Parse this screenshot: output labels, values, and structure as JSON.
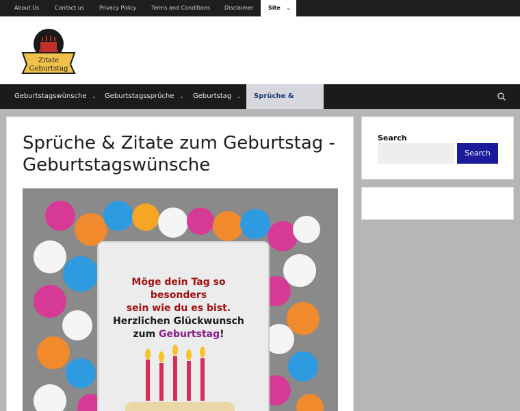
{
  "top_nav": {
    "items": [
      {
        "label": "About Us"
      },
      {
        "label": "Contact us"
      },
      {
        "label": "Privacy Policy"
      },
      {
        "label": "Terms and Conditions"
      },
      {
        "label": "Disclaimer"
      },
      {
        "label": "Site"
      }
    ]
  },
  "logo": {
    "line1": "Zitate",
    "line2": "Geburtstag"
  },
  "main_nav": {
    "items": [
      {
        "label": "Geburtstagswünsche"
      },
      {
        "label": "Geburtstagssprüche"
      },
      {
        "label": "Geburtstag"
      },
      {
        "label": "Sprüche & Zitate"
      }
    ],
    "active_index": 3
  },
  "page": {
    "title": "Sprüche & Zitate zum Geburtstag - Geburtstagswünsche"
  },
  "feature_image": {
    "line1": "Möge dein Tag so besonders",
    "line2": "sein wie du es bist.",
    "line3": "Herzlichen Glückwunsch",
    "line4_prefix": "zum ",
    "line4_highlight": "Geburtstag",
    "line4_suffix": "!"
  },
  "sidebar": {
    "search_title": "Search",
    "search_placeholder": "",
    "search_button": "Search"
  },
  "colors": {
    "topbar_bg": "#1e1e1e",
    "nav_bg": "#1b1b1b",
    "active_nav_bg": "#d6d8de",
    "active_nav_text": "#1e3a7a",
    "search_button_bg": "#1a1a9a",
    "page_bg": "#b6b6b6"
  }
}
